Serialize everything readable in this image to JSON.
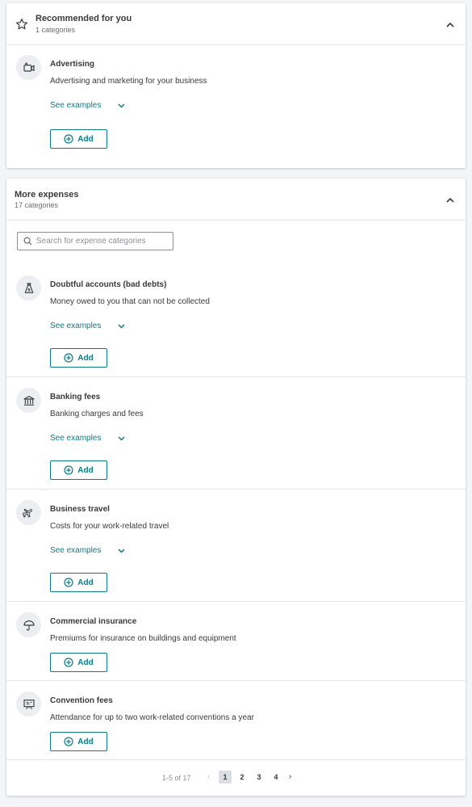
{
  "recommended": {
    "title": "Recommended for you",
    "subtitle": "1 categories",
    "icon": "star-icon",
    "items": [
      {
        "title": "Advertising",
        "description": "Advertising and marketing for your business",
        "icon": "video-camera-icon",
        "see_examples": "See examples",
        "add_label": "Add"
      }
    ]
  },
  "more": {
    "title": "More expenses",
    "subtitle": "17 categories",
    "search_placeholder": "Search for expense categories",
    "items": [
      {
        "title": "Doubtful accounts (bad debts)",
        "description": "Money owed to you that can not be collected",
        "icon": "money-bag-icon",
        "see_examples": "See examples",
        "add_label": "Add"
      },
      {
        "title": "Banking fees",
        "description": "Banking charges and fees",
        "icon": "bank-icon",
        "see_examples": "See examples",
        "add_label": "Add"
      },
      {
        "title": "Business travel",
        "description": "Costs for your work-related travel",
        "icon": "airplane-icon",
        "see_examples": "See examples",
        "add_label": "Add"
      },
      {
        "title": "Commercial insurance",
        "description": "Premiums for insurance on buildings and equipment",
        "icon": "umbrella-icon",
        "add_label": "Add"
      },
      {
        "title": "Convention fees",
        "description": "Attendance for up to two work-related conventions a year",
        "icon": "presentation-board-icon",
        "add_label": "Add"
      }
    ]
  },
  "pagination": {
    "range": "1-5 of 17",
    "prev": "‹",
    "next": "›",
    "pages": [
      "1",
      "2",
      "3",
      "4"
    ],
    "current": "1"
  },
  "colors": {
    "accent": "#0d7a8a",
    "text": "#393a3d",
    "muted": "#6b6c72"
  }
}
